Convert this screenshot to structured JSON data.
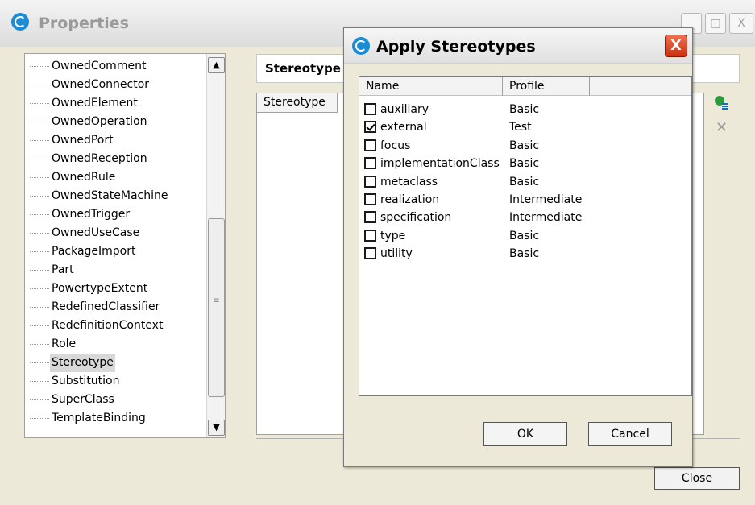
{
  "properties_window": {
    "title": "Properties",
    "buttons": {
      "minimize": "_",
      "maximize": "□",
      "close": "X"
    },
    "tree_items": [
      {
        "label": "OwnedComment"
      },
      {
        "label": "OwnedConnector"
      },
      {
        "label": "OwnedElement"
      },
      {
        "label": "OwnedOperation"
      },
      {
        "label": "OwnedPort"
      },
      {
        "label": "OwnedReception"
      },
      {
        "label": "OwnedRule"
      },
      {
        "label": "OwnedStateMachine"
      },
      {
        "label": "OwnedTrigger"
      },
      {
        "label": "OwnedUseCase"
      },
      {
        "label": "PackageImport"
      },
      {
        "label": "Part"
      },
      {
        "label": "PowertypeExtent"
      },
      {
        "label": "RedefinedClassifier"
      },
      {
        "label": "RedefinitionContext"
      },
      {
        "label": "Role"
      },
      {
        "label": "Stereotype",
        "selected": true
      },
      {
        "label": "Substitution"
      },
      {
        "label": "SuperClass"
      },
      {
        "label": "TemplateBinding"
      }
    ],
    "scroll": {
      "up": "▲",
      "down": "▼",
      "grip": "≡"
    },
    "panel_header": "Stereotype",
    "table_column": "Stereotype",
    "close_label": "Close",
    "icons": {
      "add": "add-stereotype-icon",
      "remove": "remove-stereotype-icon"
    },
    "remove_glyph": "✕"
  },
  "dialog": {
    "title": "Apply Stereotypes",
    "close_glyph": "X",
    "columns": {
      "name": "Name",
      "profile": "Profile"
    },
    "rows": [
      {
        "name": "auxiliary",
        "profile": "Basic",
        "checked": false
      },
      {
        "name": "external",
        "profile": "Test",
        "checked": true
      },
      {
        "name": "focus",
        "profile": "Basic",
        "checked": false
      },
      {
        "name": "implementationClass",
        "profile": "Basic",
        "checked": false
      },
      {
        "name": "metaclass",
        "profile": "Basic",
        "checked": false
      },
      {
        "name": "realization",
        "profile": "Intermediate",
        "checked": false
      },
      {
        "name": "specification",
        "profile": "Intermediate",
        "checked": false
      },
      {
        "name": "type",
        "profile": "Basic",
        "checked": false
      },
      {
        "name": "utility",
        "profile": "Basic",
        "checked": false
      }
    ],
    "ok_label": "OK",
    "cancel_label": "Cancel"
  },
  "colors": {
    "accent_blue": "#1c8cd6",
    "close_red": "#d04020",
    "add_green": "#2a9a3a",
    "window_bg": "#ece9d8"
  }
}
